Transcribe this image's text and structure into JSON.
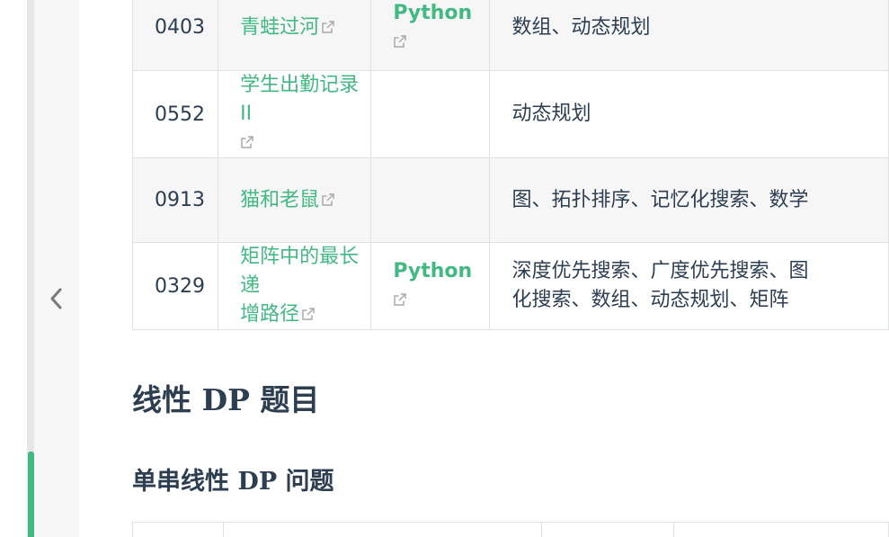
{
  "rows": [
    {
      "num": "0403",
      "title_lines": [
        "青蛙过河"
      ],
      "lang_lines": [
        "Python"
      ],
      "lang_icon_only": true,
      "tags_lines": [
        "数组、动态规划"
      ]
    },
    {
      "num": "0552",
      "title_lines": [
        "学生出勤记录 II"
      ],
      "title_icon_newline": true,
      "lang_lines": [],
      "tags_lines": [
        "动态规划"
      ]
    },
    {
      "num": "0913",
      "title_lines": [
        "猫和老鼠"
      ],
      "lang_lines": [],
      "tags_lines": [
        "图、拓扑排序、记忆化搜索、数学"
      ]
    },
    {
      "num": "0329",
      "title_lines": [
        "矩阵中的最长递",
        "增路径"
      ],
      "lang_lines": [
        "Python"
      ],
      "lang_icon_only": true,
      "tags_lines": [
        "深度优先搜索、广度优先搜索、图",
        "化搜索、数组、动态规划、矩阵"
      ]
    }
  ],
  "headings": {
    "h2": "线性 DP 题目",
    "h3": "单串线性 DP 问题"
  },
  "icons": {
    "external": "external-link-icon",
    "collapse": "chevron-left-icon"
  },
  "colors": {
    "accent": "#42b983",
    "text": "#2c3e50",
    "border": "#dfe2e5",
    "stripe": "#f6f6f6"
  }
}
